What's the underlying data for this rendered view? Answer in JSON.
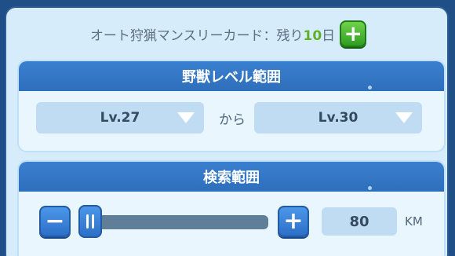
{
  "banner": {
    "text_prefix": "オート狩猟マンスリーカード：残り",
    "days_value": "10",
    "text_suffix": "日",
    "add_symbol": "+"
  },
  "level_section": {
    "title": "野獣レベル範囲",
    "from_level": "Lv.27",
    "connector": "から",
    "to_level": "Lv.30"
  },
  "search_section": {
    "title": "検索範囲",
    "minus_symbol": "−",
    "plus_symbol": "+",
    "slider_fraction": 0.0,
    "value": "80",
    "unit": "KM"
  },
  "colors": {
    "frame": "#1f4f86",
    "header": "#3a7fcf",
    "accent_green": "#5fb12a"
  }
}
